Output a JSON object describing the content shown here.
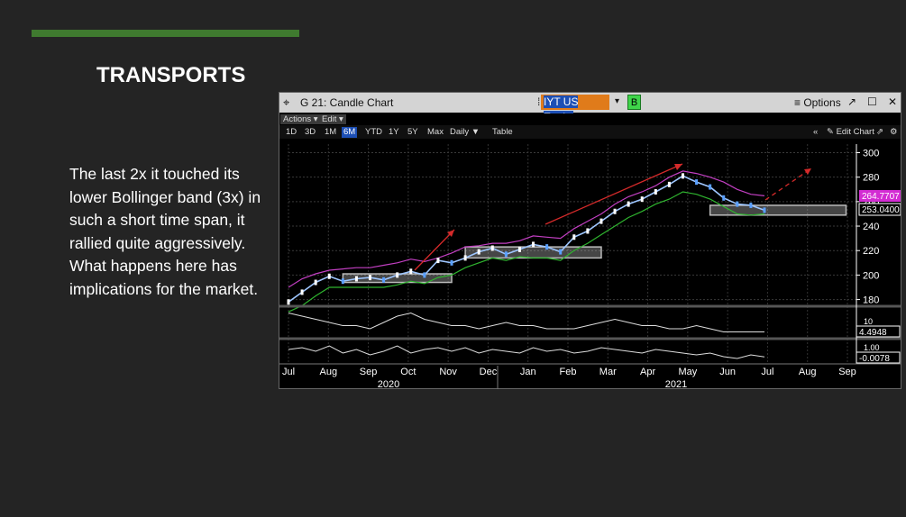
{
  "slide": {
    "title": "TRANSPORTS",
    "body": "The last 2x it touched its lower Bollinger band (3x) in such a short time span, it rallied quite aggressively. What happens here has implications for the market.",
    "accent_color": "#3f7a2f"
  },
  "window": {
    "move_icon": "⌖",
    "title": "G 21: Candle Chart",
    "ticker_cursor": "⁞",
    "ticker": "IYT US Equity",
    "ticker_dropdown": "▾",
    "b_label": "B",
    "options": "≡ Options",
    "popout_icon": "↗",
    "maximize_icon": "☐",
    "close_icon": "✕"
  },
  "toolbar": {
    "actions": "Actions ▾",
    "edit": "Edit ▾",
    "ranges": [
      "1D",
      "3D",
      "1M",
      "6M",
      "YTD",
      "1Y",
      "5Y",
      "Max"
    ],
    "selected_range": "6M",
    "daily": "Daily ▼",
    "table": "Table",
    "collapse": "«",
    "edit_chart": "✎ Edit Chart",
    "edit_icon": "⇗",
    "gear_icon": "⚙"
  },
  "chart_data": {
    "type": "line",
    "price_ticks": [
      "300",
      "280",
      "260",
      "240",
      "220",
      "200",
      "180"
    ],
    "price_range": [
      176,
      307
    ],
    "last_price": "253.0400",
    "upper_band": "264.7707",
    "ind1_tick": "10",
    "ind1_value": "4.4948",
    "ind2_tick": "1.00",
    "ind2_value": "-0.0078",
    "months": [
      "Jul",
      "Aug",
      "Sep",
      "Oct",
      "Nov",
      "Dec",
      "Jan",
      "Feb",
      "Mar",
      "Apr",
      "May",
      "Jun",
      "Jul",
      "Aug",
      "Sep"
    ],
    "years": [
      "2020",
      "2021"
    ],
    "price": [
      178,
      186,
      194,
      199,
      195,
      197,
      198,
      196,
      200,
      203,
      200,
      212,
      210,
      214,
      219,
      222,
      217,
      221,
      225,
      223,
      219,
      231,
      236,
      244,
      252,
      258,
      262,
      268,
      274,
      281,
      276,
      272,
      263,
      258,
      257,
      253
    ],
    "upper": [
      190,
      197,
      201,
      204,
      205,
      206,
      206,
      208,
      210,
      213,
      211,
      214,
      218,
      223,
      224,
      226,
      226,
      228,
      232,
      231,
      230,
      238,
      244,
      250,
      258,
      264,
      268,
      273,
      280,
      285,
      283,
      280,
      276,
      270,
      266,
      264.77
    ],
    "lower": [
      170,
      175,
      183,
      190,
      190,
      190,
      190,
      190,
      192,
      195,
      193,
      198,
      200,
      206,
      210,
      214,
      212,
      215,
      214,
      214,
      212,
      220,
      226,
      233,
      240,
      247,
      252,
      258,
      262,
      268,
      266,
      262,
      256,
      250,
      249,
      250
    ],
    "rectangles": [
      {
        "t0": 4,
        "t1": 12,
        "low": 194,
        "high": 201
      },
      {
        "t0": 13,
        "t1": 23,
        "low": 214,
        "high": 223
      },
      {
        "t0": 31,
        "t1": 41,
        "low": 249,
        "high": 257
      }
    ],
    "ind1": [
      12,
      11,
      10,
      9,
      8,
      8,
      7,
      9,
      11,
      12,
      10,
      9,
      8,
      8,
      7,
      8,
      9,
      8,
      8,
      7,
      7,
      7,
      8,
      9,
      10,
      9,
      8,
      8,
      7,
      7,
      8,
      7,
      6,
      6,
      6,
      6
    ],
    "ind2": [
      0.4,
      0.5,
      0.3,
      0.6,
      0.2,
      0.4,
      0.1,
      0.3,
      0.6,
      0.2,
      0.4,
      0.5,
      0.3,
      0.5,
      0.2,
      0.4,
      0.3,
      0.2,
      0.5,
      0.3,
      0.4,
      0.2,
      0.3,
      0.5,
      0.4,
      0.3,
      0.2,
      0.4,
      0.3,
      0.2,
      0.1,
      0.2,
      0.0,
      -0.1,
      0.1,
      -0.01
    ]
  }
}
